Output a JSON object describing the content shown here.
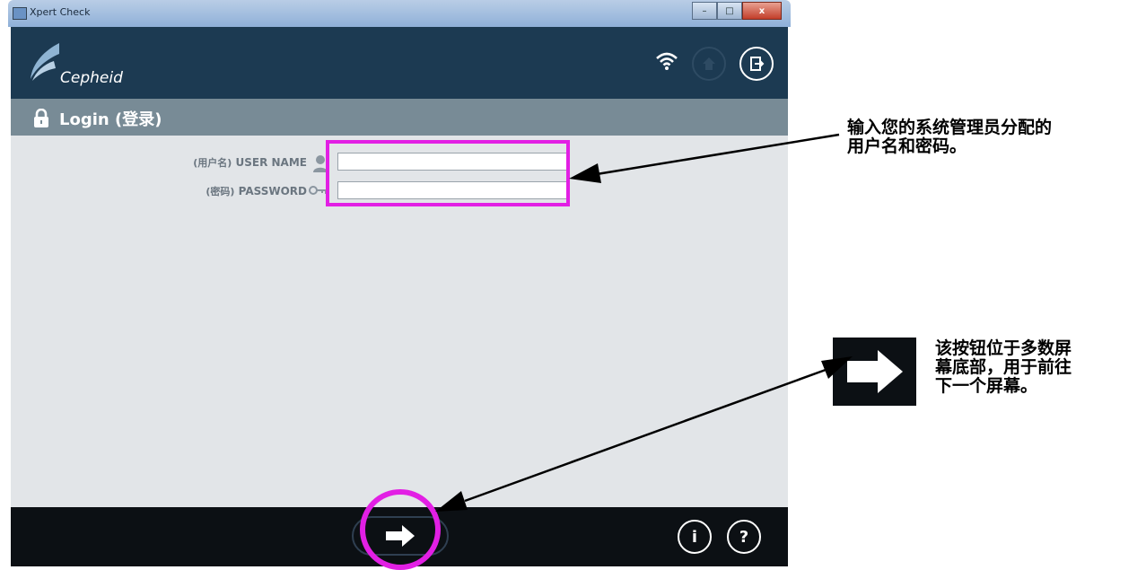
{
  "window": {
    "title": "Xpert Check",
    "buttons": {
      "minimize": "–",
      "maximize": "□",
      "close": "x"
    }
  },
  "header": {
    "logo_text": "Cepheid",
    "icons": [
      "wifi-icon",
      "home-icon",
      "exit-icon"
    ]
  },
  "login_bar": {
    "title": "Login (登录)"
  },
  "form": {
    "username": {
      "label_cn": "(用户名)",
      "label": "USER NAME",
      "value": ""
    },
    "password": {
      "label_cn": "(密码)",
      "label": "PASSWORD",
      "value": ""
    }
  },
  "footer": {
    "info_label": "i",
    "help_label": "?"
  },
  "annotations": {
    "credentials": [
      "输入您的系统管理员分配的",
      "用户名和密码。"
    ],
    "next_button": [
      "该按钮位于多数屏",
      "幕底部，用于前往",
      "下一个屏幕。"
    ]
  },
  "colors": {
    "header_bg": "#1c3a52",
    "login_bar_bg": "#788b96",
    "content_bg": "#e2e5e8",
    "footer_bg": "#0c1014",
    "highlight": "#e21fe4"
  }
}
